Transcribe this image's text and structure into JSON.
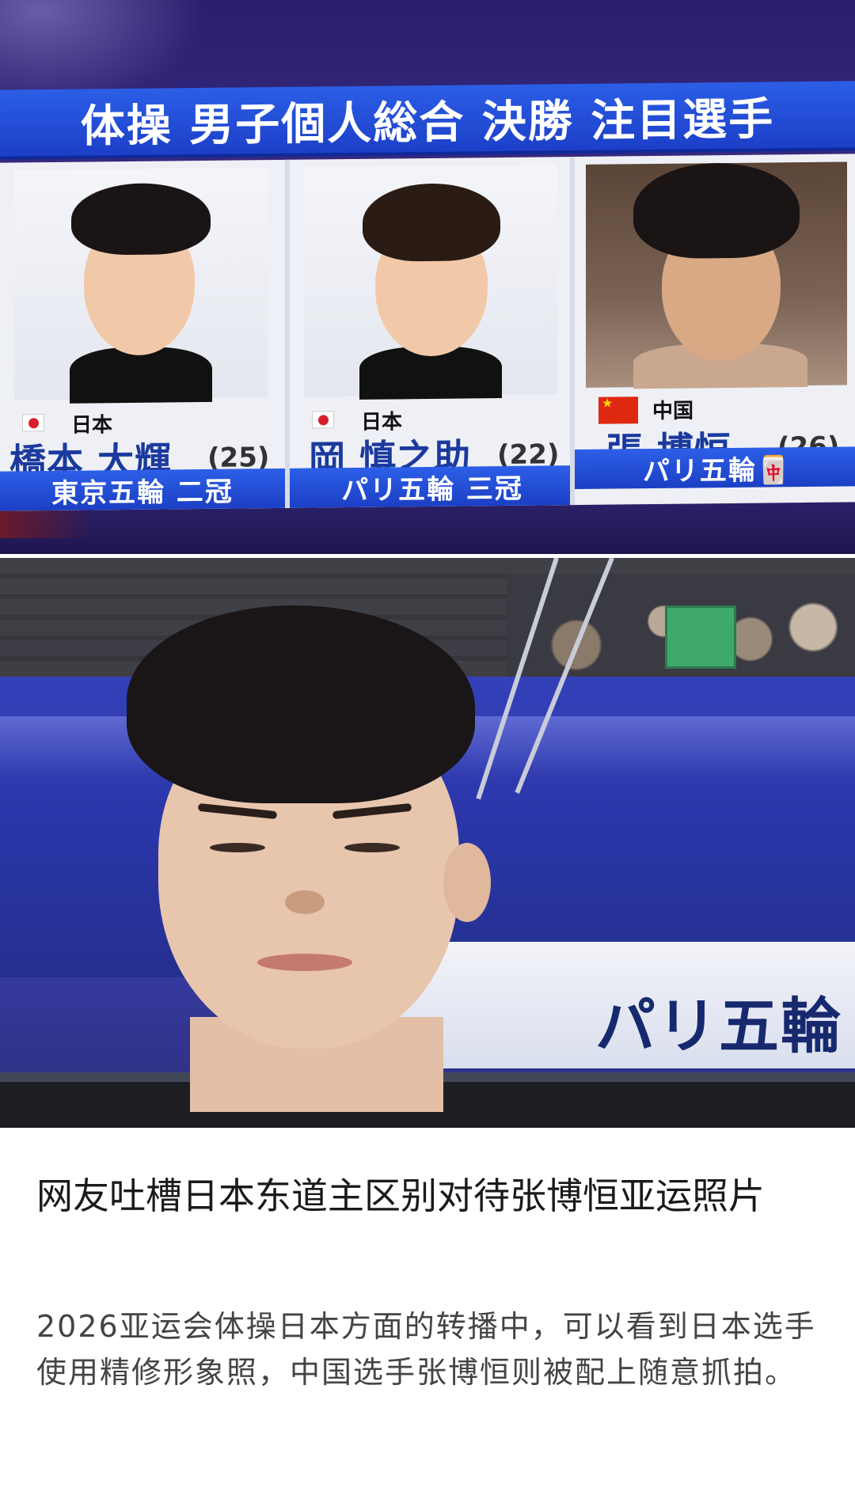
{
  "tv_graphic": {
    "title": "体操 男子個人総合 決勝 注目選手",
    "athletes": [
      {
        "country": "日本",
        "name": "橋本 大輝",
        "age": "(25)",
        "medals": "東京五輪 二冠",
        "flag": "japan-flag-icon"
      },
      {
        "country": "日本",
        "name": "岡 慎之助",
        "age": "(22)",
        "medals": "パリ五輪 三冠",
        "flag": "japan-flag-icon"
      },
      {
        "country": "中国",
        "name": "張 博恒",
        "age": "(26)",
        "medals": "パリ五輪🀄",
        "flag": "china-flag-icon"
      }
    ],
    "colors": {
      "accent": "#1f45cf",
      "name_text": "#1b3a9e"
    }
  },
  "broadcast": {
    "wall_text": "パリ五輪"
  },
  "article": {
    "headline": "网友吐槽日本东道主区别对待张博恒亚运照片",
    "summary": "2026亚运会体操日本方面的转播中，可以看到日本选手使用精修形象照，中国选手张博恒则被配上随意抓拍。"
  }
}
